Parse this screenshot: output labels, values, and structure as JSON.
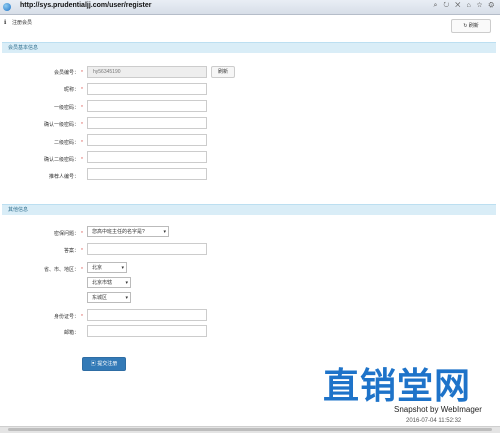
{
  "browser": {
    "url": "http://sys.prudentialjj.com/user/register",
    "icons": [
      "search-icon",
      "refresh-icon",
      "close-icon",
      "home-icon",
      "star-icon",
      "gear-icon"
    ]
  },
  "page": {
    "title": "注册会员",
    "refresh_label": "刷新"
  },
  "sections": {
    "basic": "会员基本信息",
    "other": "其他信息"
  },
  "basic_fields": {
    "member_id_label": "会员编号：",
    "member_id_value": "hy56345190",
    "refresh_id_label": "刷新",
    "nickname_label": "昵称：",
    "pwd1_label": "一级密码：",
    "pwd1_confirm_label": "确认一级密码：",
    "pwd2_label": "二级密码：",
    "pwd2_confirm_label": "确认二级密码：",
    "referrer_label": "推荐人编号："
  },
  "other_fields": {
    "security_q_label": "密保问题：",
    "security_q_value": "您高中班主任的名字是?",
    "answer_label": "答案：",
    "region_label": "省、市、地区：",
    "province": "北京",
    "city": "北京市辖",
    "district": "东城区",
    "id_label": "身份证号：",
    "email_label": "邮箱："
  },
  "submit_label": "提交注册",
  "watermark": "直销堂网",
  "snapshot": {
    "text": "Snapshot by WebImager",
    "date": "2016-07-04 11:52:32"
  },
  "colors": {
    "section_bg": "#d9edf7",
    "section_text": "#31708f",
    "submit_bg": "#337ab7",
    "required": "#d9534f",
    "watermark": "#1e73c9"
  }
}
